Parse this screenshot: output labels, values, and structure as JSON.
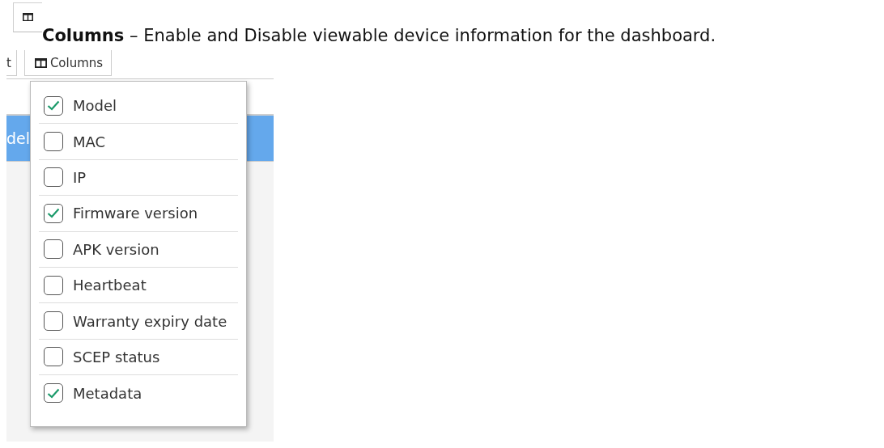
{
  "heading": {
    "text": "**Columns** – Enable and Disable viewable device information for the dashboard."
  },
  "toolbar": {
    "partial_button": "t",
    "columns_button": "Columns"
  },
  "table": {
    "header_partial": "del"
  },
  "columns_menu": [
    {
      "label": "Model",
      "checked": true
    },
    {
      "label": "MAC",
      "checked": false
    },
    {
      "label": "IP",
      "checked": false
    },
    {
      "label": "Firmware version",
      "checked": true
    },
    {
      "label": "APK version",
      "checked": false
    },
    {
      "label": "Heartbeat",
      "checked": false
    },
    {
      "label": "Warranty expiry date",
      "checked": false
    },
    {
      "label": "SCEP status",
      "checked": false
    },
    {
      "label": "Metadata",
      "checked": true
    }
  ]
}
